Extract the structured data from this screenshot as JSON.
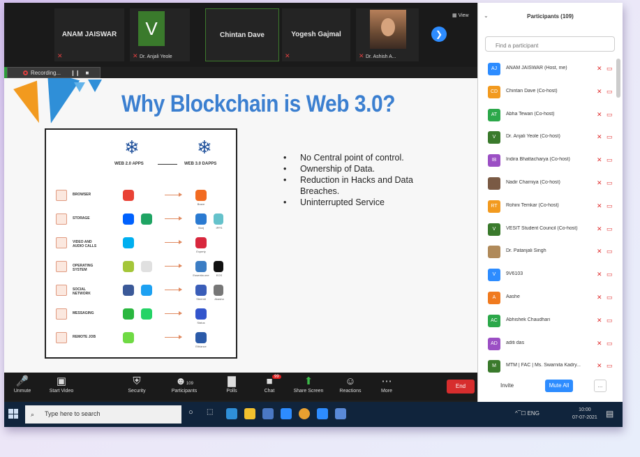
{
  "video_strip": {
    "tiles": [
      {
        "name": "ANAM JAISWAR"
      },
      {
        "initial": "V",
        "sub": "Dr. Anjali Yeole"
      },
      {
        "name": "Chintan Dave"
      },
      {
        "name": "Yogesh Gajmal"
      },
      {
        "sub": "Dr. Ashish A..."
      }
    ],
    "view_label": "View"
  },
  "recording": {
    "label": "Recording..."
  },
  "slide": {
    "title": "Why Blockchain is Web 3.0?",
    "diagram": {
      "left_header": "WEB 2.0 APPS",
      "right_header": "WEB 3.0 DAPPS",
      "rows": [
        {
          "label": "BROWSER",
          "left_colors": [
            "#e94235"
          ],
          "right_colors": [
            "#f26b21"
          ],
          "right_captions": [
            "Brave"
          ]
        },
        {
          "label": "STORAGE",
          "left_colors": [
            "#0061fe",
            "#1fa463"
          ],
          "right_colors": [
            "#2a7ad1",
            "#65c2cb"
          ],
          "right_captions": [
            "Storj",
            "IPFS"
          ]
        },
        {
          "label": "VIDEO AND AUDIO CALLS",
          "left_colors": [
            "#00aff0"
          ],
          "right_colors": [
            "#d8273d"
          ],
          "right_captions": [
            "Experty"
          ]
        },
        {
          "label": "OPERATING SYSTEM",
          "left_colors": [
            "#a4c639",
            "#e0e0e0"
          ],
          "right_colors": [
            "#3b7dc4",
            "#111111"
          ],
          "right_captions": [
            "Essentia.one",
            "EOS"
          ]
        },
        {
          "label": "SOCIAL NETWORK",
          "left_colors": [
            "#3b5998",
            "#1da1f2"
          ],
          "right_colors": [
            "#3a5db8",
            "#777777"
          ],
          "right_captions": [
            "Steemit",
            "Akasha"
          ]
        },
        {
          "label": "MESSAGING",
          "left_colors": [
            "#2ab73f",
            "#25d366"
          ],
          "right_colors": [
            "#3355cc"
          ],
          "right_captions": [
            "Status"
          ]
        },
        {
          "label": "REMOTE JOB",
          "left_colors": [
            "#6fda44"
          ],
          "right_colors": [
            "#2b5aa8"
          ],
          "right_captions": [
            "Ethlance"
          ]
        }
      ]
    },
    "bullets": [
      "No Central point of control.",
      "Ownership of Data.",
      "Reduction in Hacks and Data Breaches.",
      "Uninterrupted Service"
    ]
  },
  "controls": {
    "unmute": "Unmute",
    "start_video": "Start Video",
    "security": "Security",
    "participants": "Participants",
    "participants_count": "109",
    "polls": "Polls",
    "chat": "Chat",
    "chat_badge": "99",
    "share_screen": "Share Screen",
    "reactions": "Reactions",
    "more": "More",
    "end": "End"
  },
  "participants_panel": {
    "title": "Participants (109)",
    "search_placeholder": "Find a participant",
    "items": [
      {
        "initials": "AJ",
        "name": "ANAM JAISWAR (Host, me)",
        "color": "#2d8cff"
      },
      {
        "initials": "CD",
        "name": "Chintan Dave (Co-host)",
        "color": "#f29a1f"
      },
      {
        "initials": "AT",
        "name": "Abha Tewari (Co-host)",
        "color": "#2ca84a"
      },
      {
        "initials": "V",
        "name": "Dr. Anjali Yeole (Co-host)",
        "color": "#3a7a2c"
      },
      {
        "initials": "IB",
        "name": "Indira Bhattacharya (Co-host)",
        "color": "#9b4fc4"
      },
      {
        "initials": "",
        "name": "Nadir Charniya (Co-host)",
        "color": "#7a5a44"
      },
      {
        "initials": "RT",
        "name": "Rohini Temkar (Co-host)",
        "color": "#f29a1f"
      },
      {
        "initials": "V",
        "name": "VESIT Student Council (Co-host)",
        "color": "#3a7a2c"
      },
      {
        "initials": "",
        "name": "Dr. Patanjali Singh",
        "color": "#b08a5a"
      },
      {
        "initials": "V",
        "name": "9V6103",
        "color": "#2d8cff"
      },
      {
        "initials": "A",
        "name": "Aashe",
        "color": "#f07a1f"
      },
      {
        "initials": "AC",
        "name": "Abhishek Chaudhari",
        "color": "#2ca84a"
      },
      {
        "initials": "AD",
        "name": "aditi das",
        "color": "#9b4fc4"
      },
      {
        "initials": "M",
        "name": "MTM | FAC | Ms. Swarnita Kadry...",
        "color": "#3a7a2c"
      }
    ],
    "invite": "Invite",
    "mute_all": "Mute All",
    "more": "..."
  },
  "taskbar": {
    "search_placeholder": "Type here to search",
    "tray": "^ ̅ ☐ ENG",
    "time": "10:00",
    "date": "07-07-2021"
  }
}
